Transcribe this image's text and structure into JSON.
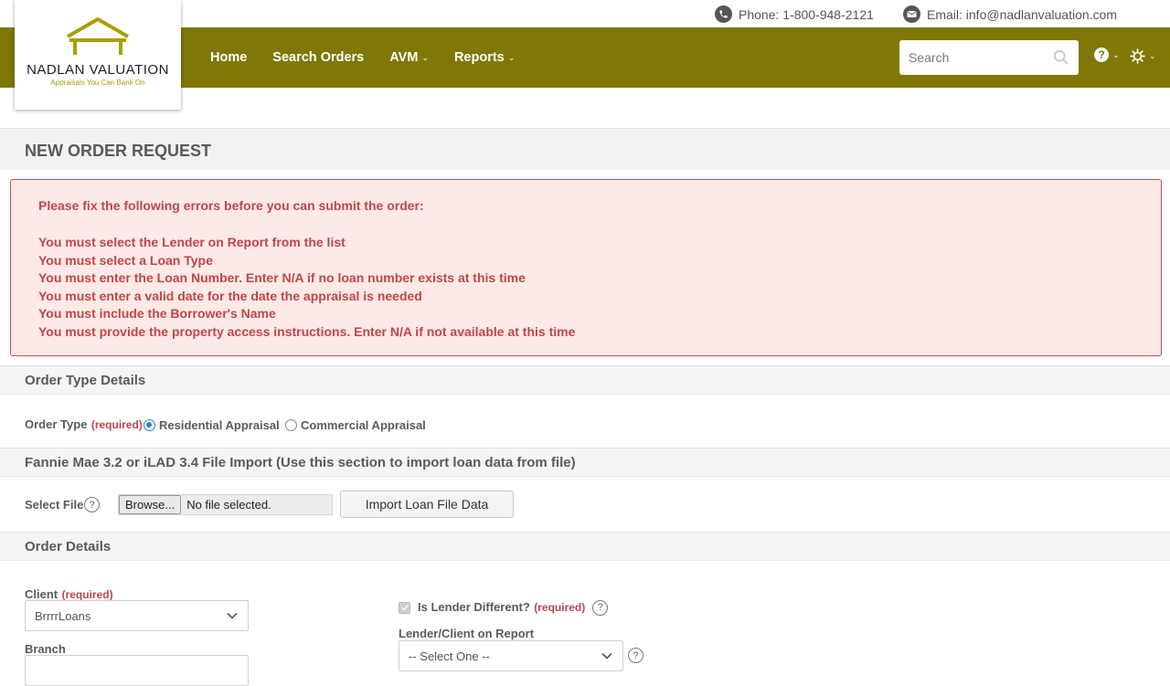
{
  "topbar": {
    "phone": "Phone: 1-800-948-2121",
    "email": "Email: info@nadlanvaluation.com"
  },
  "logo": {
    "title": "NADLAN VALUATION",
    "tagline": "Appraisals You Can Bank On"
  },
  "nav": {
    "home": "Home",
    "search_orders": "Search Orders",
    "avm": "AVM",
    "reports": "Reports",
    "search_placeholder": "Search"
  },
  "page": {
    "title": "NEW ORDER REQUEST"
  },
  "errors": {
    "heading": "Please fix the following errors before you can submit the order:",
    "items": [
      "You must select the Lender on Report from the list",
      "You must select a Loan Type",
      "You must enter the Loan Number. Enter N/A if no loan number exists at this time",
      "You must enter a valid date for the date the appraisal is needed",
      "You must include the Borrower's Name",
      "You must provide the property access instructions. Enter N/A if not available at this time"
    ]
  },
  "order_type_section": {
    "title": "Order Type Details",
    "label": "Order Type",
    "required": "(required)",
    "options": [
      "Residential Appraisal",
      "Commercial Appraisal"
    ],
    "selected": "Residential Appraisal"
  },
  "import_section": {
    "title": "Fannie Mae 3.2 or iLAD 3.4 File Import (Use this section to import loan data from file)",
    "select_file_label": "Select File",
    "browse_label": "Browse...",
    "file_status": "No file selected.",
    "import_button": "Import Loan File Data"
  },
  "order_details": {
    "title": "Order Details",
    "client_label": "Client",
    "client_required": "(required)",
    "client_value": "BrrrrLoans",
    "branch_label": "Branch",
    "lender_different_label": "Is Lender Different?",
    "lender_different_required": "(required)",
    "lender_on_report_label": "Lender/Client on Report",
    "lender_on_report_value": "-- Select One --"
  },
  "colors": {
    "brand_olive": "#7f7806",
    "error_text": "#c0454e",
    "error_bg": "#fde9e6"
  }
}
